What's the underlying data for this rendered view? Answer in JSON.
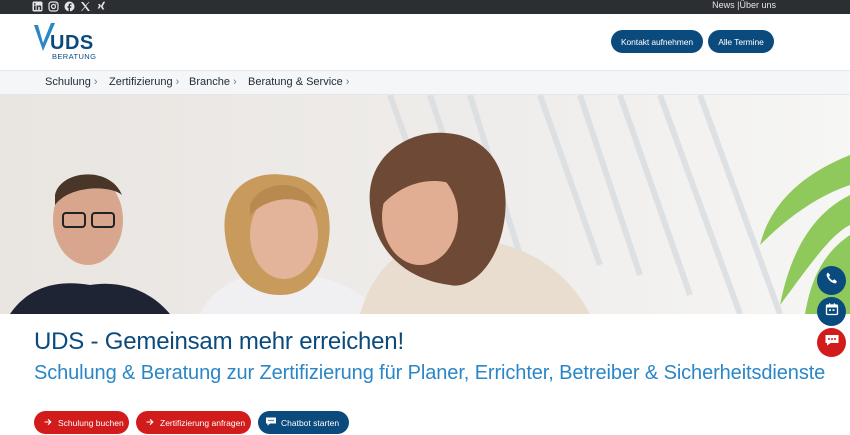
{
  "topbar": {
    "social_icons": [
      "linkedin-icon",
      "instagram-icon",
      "facebook-icon",
      "x-icon",
      "xing-icon"
    ],
    "links": [
      "News",
      "Über uns"
    ],
    "separator": "|"
  },
  "header": {
    "logo_main": "UDS",
    "logo_sub": "BERATUNG",
    "contact_button": "Kontakt aufnehmen",
    "dates_button": "Alle Termine"
  },
  "nav": {
    "items": [
      {
        "label": "Schulung"
      },
      {
        "label": "Zertifizierung"
      },
      {
        "label": "Branche"
      },
      {
        "label": "Beratung & Service"
      }
    ],
    "chevron": "›"
  },
  "hero": {
    "headline": "UDS - Gemeinsam mehr erreichen!",
    "subline": "Schulung & Beratung zur Zertifizierung für Planer, Errichter, Betreiber & Sicherheitsdienste"
  },
  "cta": {
    "book": "Schulung buchen",
    "certify": "Zertifizierung anfragen",
    "chatbot": "Chatbot starten"
  },
  "floating": [
    "phone-icon",
    "calendar-icon",
    "chat-icon"
  ],
  "colors": {
    "brand_blue": "#0b4a7d",
    "accent_blue": "#2a86c7",
    "cta_red": "#d21c1c",
    "topbar": "#2b2f33"
  }
}
